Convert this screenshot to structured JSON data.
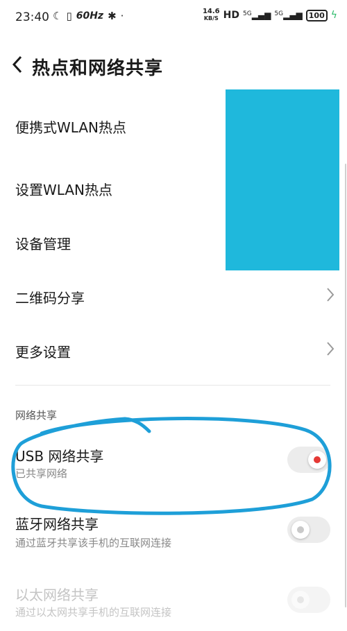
{
  "status_bar": {
    "time": "23:40",
    "refresh_rate": "60Hz",
    "net_speed_value": "14.6",
    "net_speed_unit": "KB/S",
    "hd_label": "HD",
    "network_1": "5G",
    "network_2": "5G",
    "battery": "100"
  },
  "header": {
    "title": "热点和网络共享"
  },
  "menu": {
    "portable_wlan": "便携式WLAN热点",
    "set_wlan": "设置WLAN热点",
    "device_mgmt": "设备管理",
    "qr_share": "二维码分享",
    "more_settings": "更多设置"
  },
  "section": {
    "title": "网络共享",
    "usb": {
      "label": "USB 网络共享",
      "subtitle": "已共享网络",
      "on": true
    },
    "bluetooth": {
      "label": "蓝牙网络共享",
      "subtitle": "通过蓝牙共享该手机的互联网连接",
      "on": false
    },
    "ethernet": {
      "label": "以太网络共享",
      "subtitle": "通过以太网共享手机的互联网连接",
      "on": false,
      "disabled": true
    }
  },
  "colors": {
    "toggle_on_dot": "#e53935",
    "toggle_off_dot": "#c9c9c9",
    "annotation": "#1e9fd8",
    "redaction": "#1fb8dc"
  }
}
